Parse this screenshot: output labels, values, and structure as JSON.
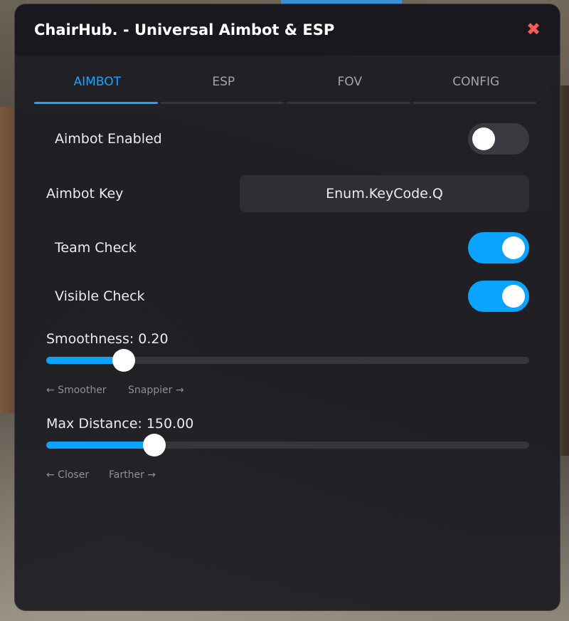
{
  "window": {
    "title": "ChairHub. - Universal Aimbot & ESP",
    "close_glyph": "✖",
    "close_icon": "close-icon",
    "accent_color": "#0aa3ff"
  },
  "tabs": [
    {
      "label": "AIMBOT",
      "active": true
    },
    {
      "label": "ESP",
      "active": false
    },
    {
      "label": "FOV",
      "active": false
    },
    {
      "label": "CONFIG",
      "active": false
    }
  ],
  "aimbot": {
    "enabled": {
      "label": "Aimbot Enabled",
      "on": false
    },
    "key": {
      "label": "Aimbot Key",
      "value": "Enum.KeyCode.Q"
    },
    "team_check": {
      "label": "Team Check",
      "on": true
    },
    "visible_check": {
      "label": "Visible Check",
      "on": true
    },
    "smoothness": {
      "label": "Smoothness: 0.20",
      "fill_fraction": 0.16,
      "hint_left": "← Smoother",
      "hint_right": "Snappier →"
    },
    "max_distance": {
      "label": "Max Distance: 150.00",
      "fill_fraction": 0.224,
      "hint_left": "← Closer",
      "hint_right": "Farther →"
    }
  }
}
